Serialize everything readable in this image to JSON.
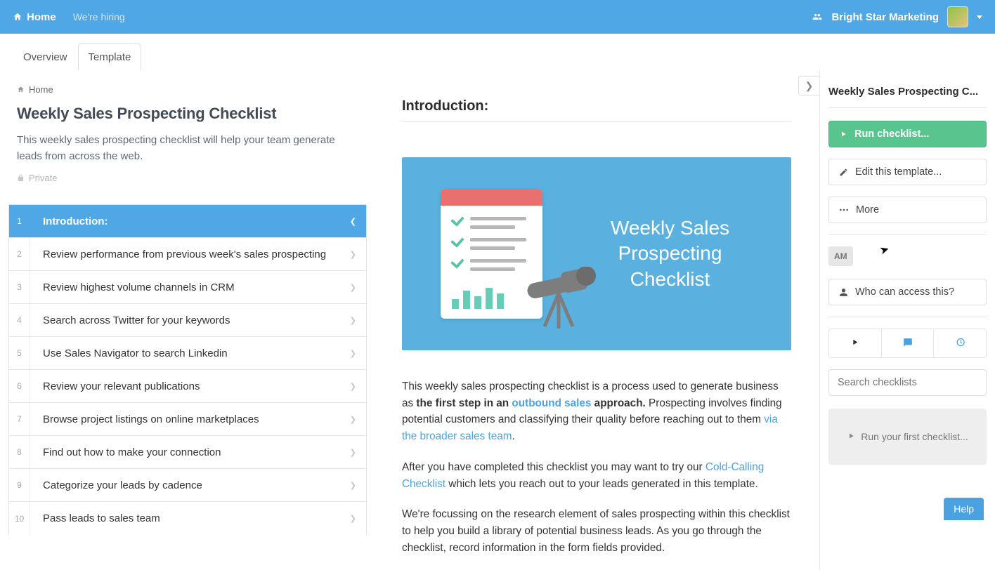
{
  "topbar": {
    "home": "Home",
    "hiring": "We're hiring",
    "org": "Bright Star Marketing"
  },
  "tabs": {
    "overview": "Overview",
    "template": "Template"
  },
  "breadcrumb": {
    "home": "Home"
  },
  "page": {
    "title": "Weekly Sales Prospecting Checklist",
    "desc": "This weekly sales prospecting checklist will help your team generate leads from across the web.",
    "private": "Private"
  },
  "steps": [
    {
      "n": "1",
      "label": "Introduction:"
    },
    {
      "n": "2",
      "label": "Review performance from previous week's sales prospecting"
    },
    {
      "n": "3",
      "label": "Review highest volume channels in CRM"
    },
    {
      "n": "4",
      "label": "Search across Twitter for your keywords"
    },
    {
      "n": "5",
      "label": "Use Sales Navigator to search Linkedin"
    },
    {
      "n": "6",
      "label": "Review your relevant publications"
    },
    {
      "n": "7",
      "label": "Browse project listings on online marketplaces"
    },
    {
      "n": "8",
      "label": "Find out how to make your connection"
    },
    {
      "n": "9",
      "label": "Categorize your leads by cadence"
    },
    {
      "n": "10",
      "label": "Pass leads to sales team"
    }
  ],
  "content": {
    "heading": "Introduction:",
    "hero_title_1": "Weekly Sales",
    "hero_title_2": "Prospecting Checklist",
    "p1_a": "This weekly sales prospecting checklist is a process used to generate business as ",
    "p1_b": "the first step in an ",
    "p1_link1": "outbound sales",
    "p1_c": " approach.",
    "p1_d": " Prospecting involves finding potential customers and classifying their quality before reaching out to them ",
    "p1_link2": "via the broader sales team",
    "p1_e": ".",
    "p2_a": "After you have completed this checklist you may want to try our ",
    "p2_link": "Cold-Calling Checklist",
    "p2_b": " which lets you reach out to your leads generated in this template.",
    "p3": "We're focussing on the research element of sales prospecting within this checklist to help you build a library of potential business leads. As you go through the checklist, record information in the form fields provided."
  },
  "side": {
    "title": "Weekly Sales Prospecting C...",
    "run": "Run checklist...",
    "edit": "Edit this template...",
    "more": "More",
    "am": "AM",
    "access": "Who can access this?",
    "search_placeholder": "Search checklists",
    "run_first": "Run your first checklist..."
  },
  "help": "Help"
}
